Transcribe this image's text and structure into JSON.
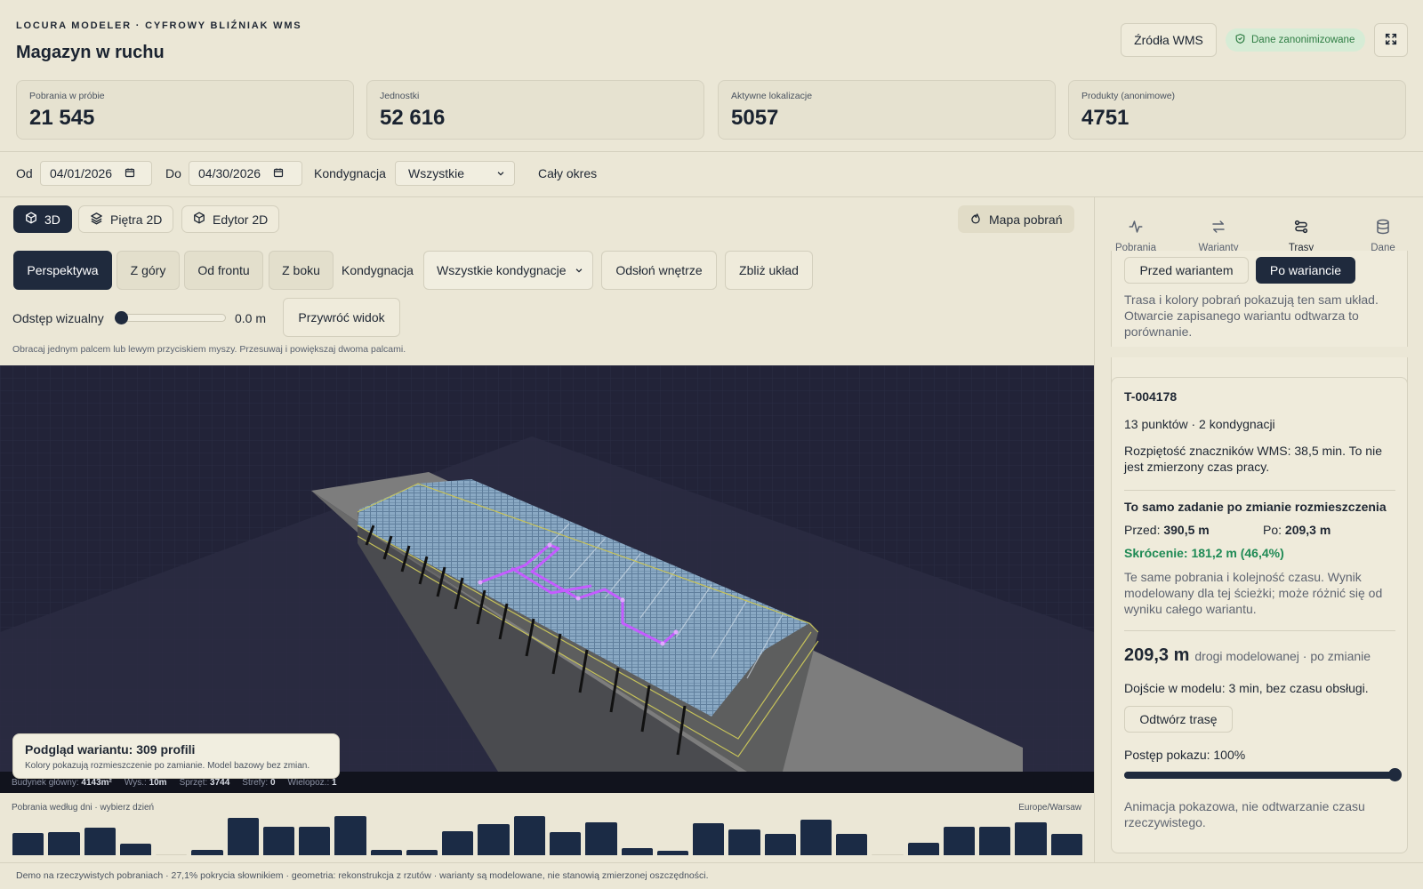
{
  "header": {
    "kicker": "LOCURA MODELER · CYFROWY BLIŹNIAK WMS",
    "title": "Magazyn w ruchu",
    "sources_button": "Źródła WMS",
    "anon_badge": "Dane zanonimizowane"
  },
  "stats": [
    {
      "label": "Pobrania w próbie",
      "value": "21 545"
    },
    {
      "label": "Jednostki",
      "value": "52 616"
    },
    {
      "label": "Aktywne lokalizacje",
      "value": "5057"
    },
    {
      "label": "Produkty (anonimowe)",
      "value": "4751"
    }
  ],
  "filters": {
    "from_label": "Od",
    "from_value": "04/01/2026",
    "to_label": "Do",
    "to_value": "04/30/2026",
    "floor_label": "Kondygnacja",
    "floor_value": "Wszystkie",
    "whole_period": "Cały okres"
  },
  "view_tabs": [
    "3D",
    "Piętra 2D",
    "Edytor 2D"
  ],
  "heatmap_button": "Mapa pobrań",
  "camera": {
    "buttons": [
      "Perspektywa",
      "Z góry",
      "Od frontu",
      "Z boku"
    ],
    "floor_label": "Kondygnacja",
    "floor_value": "Wszystkie kondygnacje",
    "reveal_button": "Odsłoń wnętrze",
    "zoom_button": "Zbliż układ",
    "spacing_label": "Odstęp wizualny",
    "spacing_value": "0.0 m",
    "reset_button": "Przywróć widok",
    "hint": "Obracaj jednym palcem lub lewym przyciskiem myszy. Przesuwaj i powiększaj dwoma palcami."
  },
  "variant_preview": {
    "title": "Podgląd wariantu: 309 profili",
    "subtitle": "Kolory pokazują rozmieszczenie po zamianie. Model bazowy bez zmian."
  },
  "statusbar": [
    {
      "label": "Budynek główny:",
      "value": "4143m²"
    },
    {
      "label": "Wys.:",
      "value": "10m"
    },
    {
      "label": "Sprzęt:",
      "value": "3744"
    },
    {
      "label": "Strefy:",
      "value": "0"
    },
    {
      "label": "Wielopoz.:",
      "value": "1"
    }
  ],
  "day_chart": {
    "label": "Pobrania według dni · wybierz dzień",
    "timezone": "Europe/Warsaw",
    "values": [
      24,
      25,
      30,
      12,
      0,
      6,
      40,
      31,
      31,
      42,
      6,
      6,
      26,
      33,
      42,
      25,
      35,
      8,
      5,
      34,
      28,
      23,
      38,
      23,
      0,
      13,
      31,
      31,
      35,
      23
    ]
  },
  "right_panel": {
    "tabs": [
      {
        "label": "Pobrania",
        "icon": "activity-icon"
      },
      {
        "label": "Warianty",
        "icon": "swap-icon"
      },
      {
        "label": "Trasy",
        "icon": "route-icon"
      },
      {
        "label": "Dane",
        "icon": "database-icon"
      }
    ],
    "compare_before": "Przed wariantem",
    "compare_after": "Po wariancie",
    "compare_note": "Trasa i kolory pobrań pokazują ten sam układ. Otwarcie zapisanego wariantu odtwarza to porównanie.",
    "route_id": "T-004178",
    "route_points": "13 punktów · 2 kondygnacji",
    "route_span": "Rozpiętość znaczników WMS: 38,5 min. To nie jest zmierzony czas pracy.",
    "same_task_title": "To samo zadanie po zmianie rozmieszczenia",
    "before_label": "Przed:",
    "before_value": "390,5 m",
    "after_label": "Po:",
    "after_value": "209,3 m",
    "reduction": "Skrócenie: 181,2 m (46,4%)",
    "model_note": "Te same pobrania i kolejność czasu. Wynik modelowany dla tej ścieżki; może różnić się od wyniku całego wariantu.",
    "distance_value": "209,3 m",
    "distance_suffix": "drogi modelowanej · po zmianie",
    "walk_note": "Dojście w modelu: 3 min, bez czasu obsługi.",
    "replay_button": "Odtwórz trasę",
    "progress_label": "Postęp pokazu: 100%",
    "progress": 1.0,
    "anim_note": "Animacja pokazowa, nie odtwarzanie czasu rzeczywistego."
  },
  "footer": "Demo na rzeczywistych pobraniach · 27,1% pokrycia słownikiem · geometria: rekonstrukcja z rzutów · warianty są modelowane, nie stanowią zmierzonej oszczędności.",
  "colors": {
    "accent_dark": "#1f2a3d",
    "bar": "#1b2b45",
    "success": "#1f8a55",
    "viewport_bg": "#222338",
    "route": "#c45cff"
  }
}
